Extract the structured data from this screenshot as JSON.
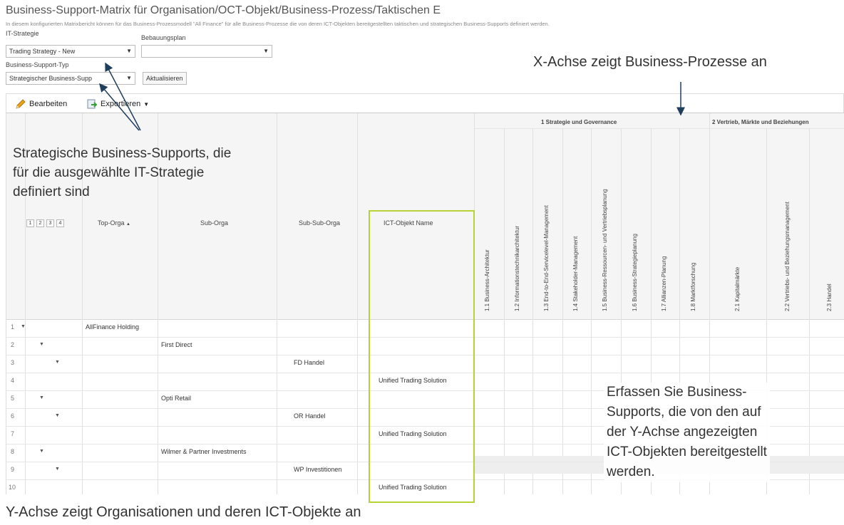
{
  "header": {
    "title": "Business-Support-Matrix für Organisation/OCT-Objekt/Business-Prozess/Taktischen E",
    "subtitle": "In diesem konfigurierten Matrixbericht können für das Business-Prozessmodell \"All Finance\" für alle Business-Prozesse die von deren ICT-Objekten bereitgestellten taktischen und strategischen Business-Supports definiert werden."
  },
  "filters": {
    "it_strategy_label": "IT-Strategie",
    "it_strategy_value": "Trading Strategy - New",
    "plan_label": "Bebauungsplan",
    "plan_value": "",
    "support_type_label": "Business-Support-Typ",
    "support_type_value": "Strategischer Business-Supp",
    "refresh_label": "Aktualisieren"
  },
  "toolbar": {
    "edit_label": "Bearbeiten",
    "export_label": "Exportieren"
  },
  "grid": {
    "group_headers": [
      "1 Strategie und Governance",
      "2 Vertrieb, Märkte und Beziehungen"
    ],
    "level_buttons": [
      "1",
      "2",
      "3",
      "4"
    ],
    "columns": {
      "top": "Top-Orga",
      "sort_indicator": "▲",
      "sub": "Sub-Orga",
      "subsub": "Sub-Sub-Orga",
      "ict": "ICT-Objekt Name"
    },
    "process_columns": [
      "1.1 Business-Architektur",
      "1.2 Informationstechnikarchitektur",
      "1.3 End-to-End-Servicelevel-Management",
      "1.4 Stakeholder-Management",
      "1.5 Business-Ressourcen- und Vertriebsplanung",
      "1.6 Business-Strategieplanung",
      "1.7 Allianzen-Planung",
      "1.8 Marktforschung",
      "2.1 Kapitalmärkte",
      "2.2 Vertriebs- und Beziehungsmanagement",
      "2.3 Handel"
    ],
    "rows": [
      {
        "num": "1",
        "top": "AllFinance Holding",
        "sub": "",
        "subsub": "",
        "ict": ""
      },
      {
        "num": "2",
        "top": "",
        "sub": "First Direct",
        "subsub": "",
        "ict": ""
      },
      {
        "num": "3",
        "top": "",
        "sub": "",
        "subsub": "FD Handel",
        "ict": ""
      },
      {
        "num": "4",
        "top": "",
        "sub": "",
        "subsub": "",
        "ict": "Unified Trading Solution"
      },
      {
        "num": "5",
        "top": "",
        "sub": "Opti Retail",
        "subsub": "",
        "ict": ""
      },
      {
        "num": "6",
        "top": "",
        "sub": "",
        "subsub": "OR Handel",
        "ict": ""
      },
      {
        "num": "7",
        "top": "",
        "sub": "",
        "subsub": "",
        "ict": "Unified Trading Solution"
      },
      {
        "num": "8",
        "top": "",
        "sub": "Wilmer & Partner Investments",
        "subsub": "",
        "ict": ""
      },
      {
        "num": "9",
        "top": "",
        "sub": "",
        "subsub": "WP Investitionen",
        "ict": ""
      },
      {
        "num": "10",
        "top": "",
        "sub": "",
        "subsub": "",
        "ict": "Unified Trading Solution"
      }
    ]
  },
  "annotations": {
    "x_axis": "X-Achse zeigt Business-Prozesse an",
    "strategic_line1": "Strategische Business-Supports, die",
    "strategic_line2": "für die ausgewählte IT-Strategie",
    "strategic_line3": "definiert sind",
    "capture_line1": "Erfassen Sie Business-",
    "capture_line2": "Supports, die von den auf",
    "capture_line3": "der Y-Achse angezeigten",
    "capture_line4": "ICT-Objekten bereitgestellt",
    "capture_line5": "werden.",
    "y_axis": "Y-Achse zeigt Organisationen und deren ICT-Objekte an"
  },
  "colors": {
    "highlight_border": "#b5d334",
    "arrow": "#1f3d5c"
  }
}
